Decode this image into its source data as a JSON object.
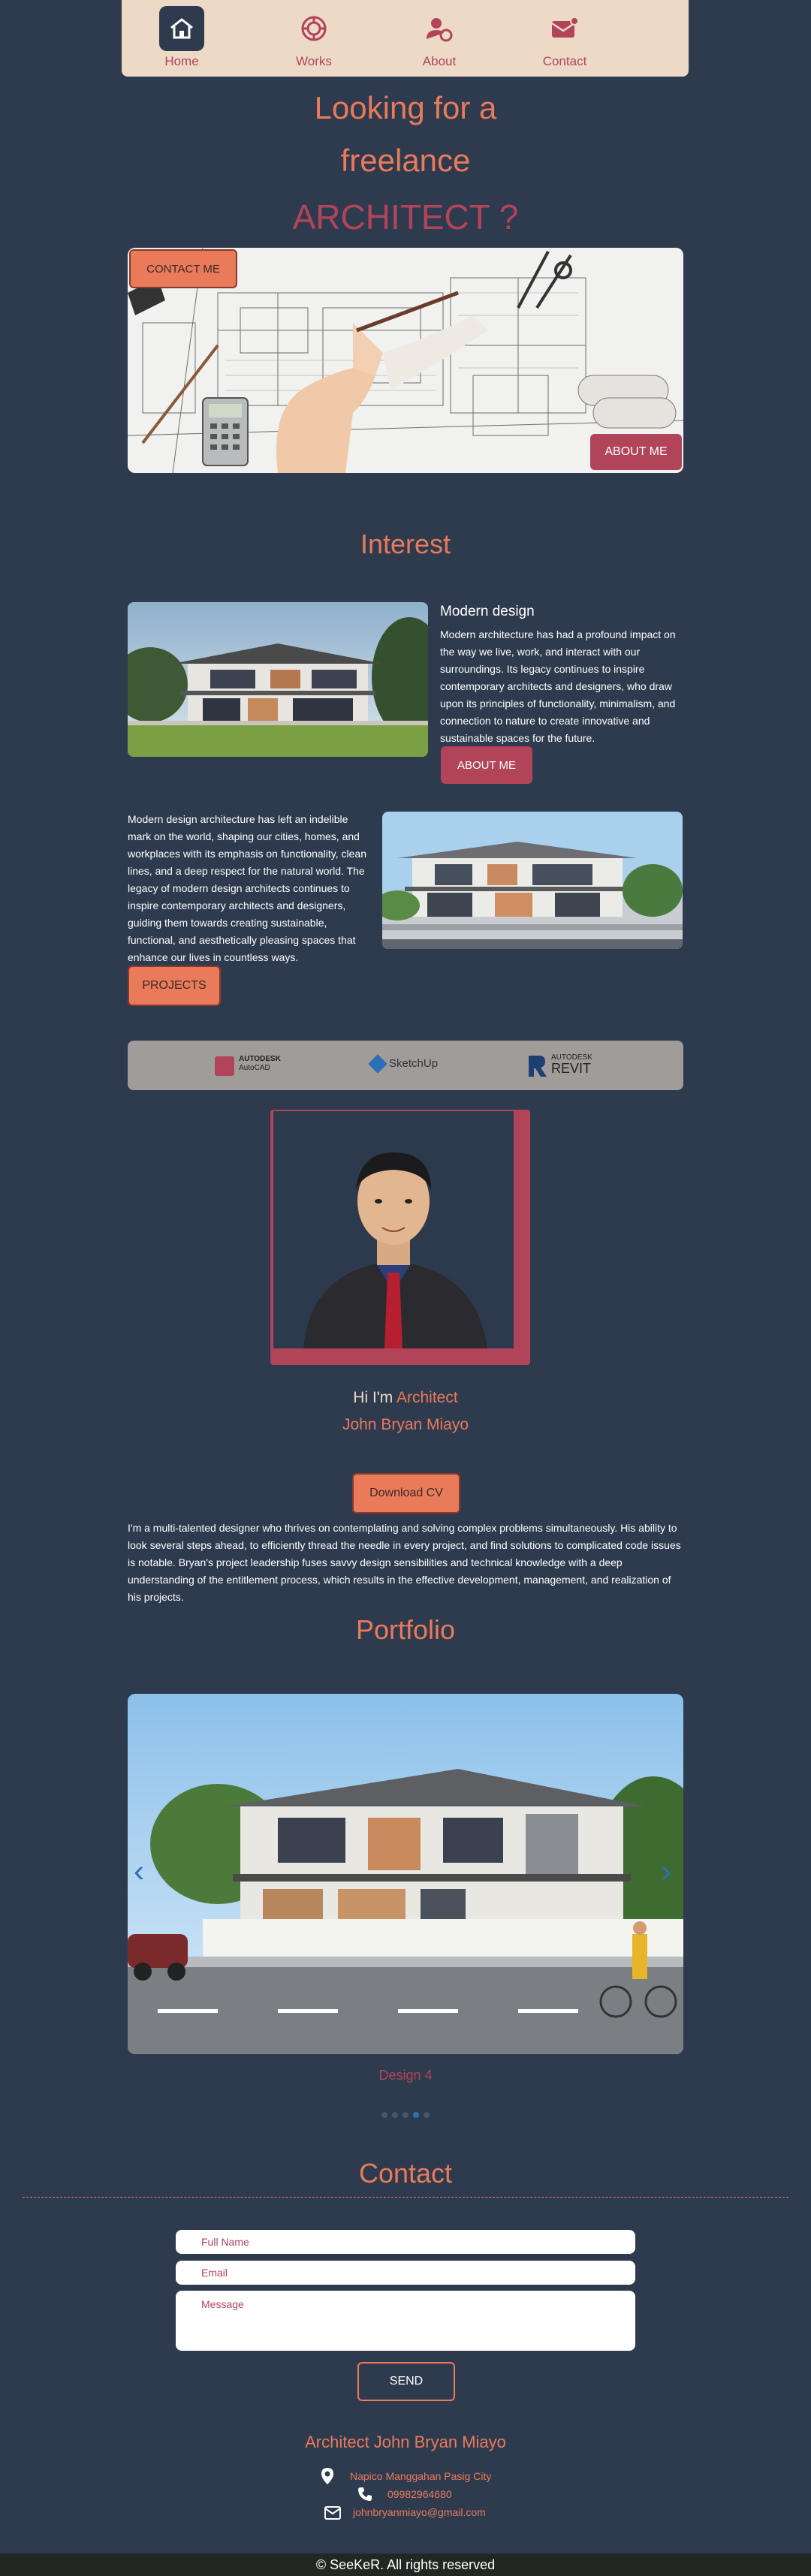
{
  "nav": {
    "items": [
      {
        "label": "Home",
        "icon": "home-icon",
        "active": true
      },
      {
        "label": "Works",
        "icon": "works-icon",
        "active": false
      },
      {
        "label": "About",
        "icon": "about-icon",
        "active": false
      },
      {
        "label": "Contact",
        "icon": "contact-icon",
        "active": false
      }
    ]
  },
  "hero": {
    "line1": "Looking for a",
    "line2": "freelance",
    "line3": "ARCHITECT ?",
    "contact_button": "CONTACT ME",
    "about_button": "ABOUT ME"
  },
  "interest": {
    "title": "Interest",
    "block1_heading": "Modern design",
    "block1_text": "Modern architecture has had a profound impact on the way we live, work, and interact with our surroundings. Its legacy continues to inspire contemporary architects and designers, who draw upon its principles of functionality, minimalism, and connection to nature to create innovative and sustainable spaces for the future.",
    "block1_button": "ABOUT ME",
    "block2_text": "Modern design architecture has left an indelible mark on the world, shaping our cities, homes, and workplaces with its emphasis on functionality, clean lines, and a deep respect for the natural world. The legacy of modern design architects continues to inspire contemporary architects and designers, guiding them towards creating sustainable, functional, and aesthetically pleasing spaces that enhance our lives in countless ways.",
    "block2_button": "PROJECTS"
  },
  "tools": {
    "autocad_line1": "AUTODESK",
    "autocad_line2": "AutoCAD",
    "sketchup": "SketchUp",
    "revit_line1": "AUTODESK",
    "revit_line2": "REVIT"
  },
  "profile": {
    "greeting": "Hi I'm ",
    "role": "Architect",
    "name": "John Bryan Miayo",
    "download_button": "Download CV",
    "bio": "I'm a multi-talented designer who thrives on contemplating and solving complex problems simultaneously. His ability to look several steps ahead, to efficiently thread the needle in every project, and find solutions to complicated code issues is notable. Bryan's project leadership fuses savvy design sensibilities and technical knowledge with a deep understanding of the entitlement process, which results in the effective development, management, and realization of his projects."
  },
  "portfolio": {
    "title": "Portfolio",
    "caption": "Design 4",
    "dots_count": 5,
    "active_dot": 4
  },
  "contact": {
    "title": "Contact",
    "name_placeholder": "Full Name",
    "email_placeholder": "Email",
    "message_placeholder": "Message",
    "send_button": "SEND",
    "footer_name": "Architect John Bryan Miayo",
    "address": "Napico Manggahan Pasig City",
    "phone": "09982964680",
    "email": "johnbryanmiayo@gmail.com"
  },
  "footer": {
    "copyright": "© SeeKeR. All rights reserved"
  },
  "colors": {
    "background": "#2e3b4e",
    "accent_orange": "#e97a5a",
    "accent_red": "#b2445a",
    "nav_bg": "#ecd9c6"
  }
}
